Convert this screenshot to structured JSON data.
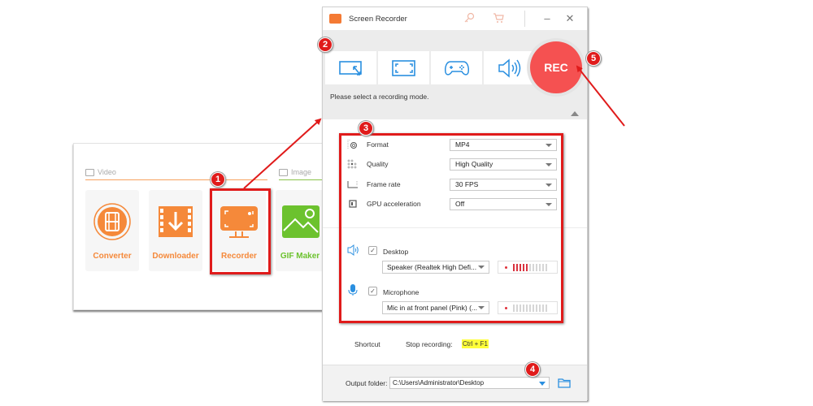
{
  "main_window": {
    "sections": [
      {
        "label": "Video",
        "icon": "video-icon",
        "accent": "#f7a25f"
      },
      {
        "label": "Image",
        "icon": "image-icon",
        "accent": "#8bc34a"
      }
    ],
    "tools": [
      {
        "label": "Converter",
        "icon": "film-reel-icon",
        "color": "#f5893a"
      },
      {
        "label": "Downloader",
        "icon": "download-film-icon",
        "color": "#f5893a"
      },
      {
        "label": "Recorder",
        "icon": "monitor-record-icon",
        "color": "#f5893a"
      },
      {
        "label": "GIF Maker",
        "icon": "mountain-image-icon",
        "color": "#6cc22e"
      }
    ]
  },
  "recorder_window": {
    "title": "Screen Recorder",
    "title_icons": [
      "key-icon",
      "cart-icon"
    ],
    "window_controls": {
      "minimize": "–",
      "close": "✕"
    },
    "modes": [
      {
        "name": "region",
        "icon": "region-select-icon"
      },
      {
        "name": "fullscreen",
        "icon": "fullscreen-icon"
      },
      {
        "name": "game",
        "icon": "gamepad-icon"
      },
      {
        "name": "audio",
        "icon": "speaker-icon"
      }
    ],
    "rec_label": "REC",
    "mode_hint": "Please select a recording mode.",
    "settings": [
      {
        "label": "Format",
        "value": "MP4",
        "icon": "format-gear-icon"
      },
      {
        "label": "Quality",
        "value": "High Quality",
        "icon": "quality-icon"
      },
      {
        "label": "Frame rate",
        "value": "30 FPS",
        "icon": "frame-rate-icon"
      },
      {
        "label": "GPU acceleration",
        "value": "Off",
        "icon": "gpu-chip-icon"
      }
    ],
    "audio": {
      "desktop": {
        "label": "Desktop",
        "checked": true,
        "device": "Speaker (Realtek High Defi...",
        "level_bars_on": 5,
        "level_bars_total": 11
      },
      "microphone": {
        "label": "Microphone",
        "checked": true,
        "device": "Mic in at front panel (Pink) (...",
        "level_bars_on": 0,
        "level_bars_total": 11
      }
    },
    "shortcut": {
      "label": "Shortcut",
      "action": "Stop recording:",
      "keys": "Ctrl + F1"
    },
    "output": {
      "label": "Output folder:",
      "path": "C:\\Users\\Administrator\\Desktop"
    },
    "accent": "#2a8fe0",
    "rec_color": "#f55151"
  },
  "annotations": {
    "badges": [
      "1",
      "2",
      "3",
      "4",
      "5"
    ],
    "color": "#e01b1b"
  }
}
